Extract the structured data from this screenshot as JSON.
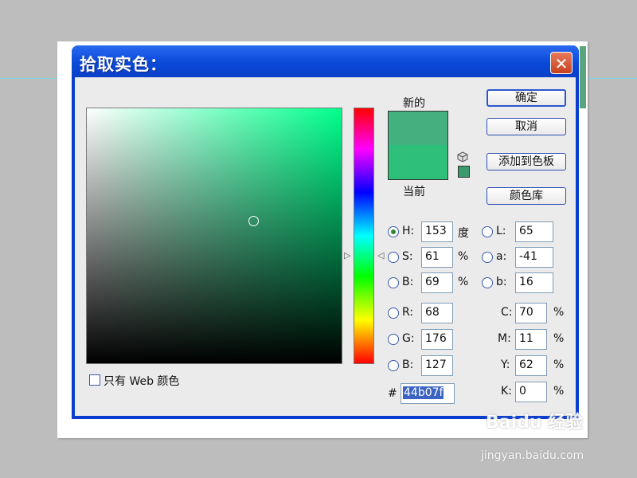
{
  "dialog": {
    "title": "拾取实色：",
    "close_glyph": "✕"
  },
  "picker": {
    "label_new": "新的",
    "label_current": "当前",
    "new_color": "#44b07f",
    "current_color": "#2ebf7a",
    "web_swatch_color": "#3a9a6c",
    "hue_arrow_left": "▷",
    "hue_arrow_right": "◁"
  },
  "buttons": {
    "ok": "确定",
    "cancel": "取消",
    "add_to_swatches": "添加到色板",
    "color_libraries": "颜色库"
  },
  "hsb": {
    "h_label": "H:",
    "h_value": "153",
    "h_unit": "度",
    "s_label": "S:",
    "s_value": "61",
    "s_unit": "%",
    "b_label": "B:",
    "b_value": "69",
    "b_unit": "%"
  },
  "rgb": {
    "r_label": "R:",
    "r_value": "68",
    "g_label": "G:",
    "g_value": "176",
    "b_label": "B:",
    "b_value": "127"
  },
  "lab": {
    "l_label": "L:",
    "l_value": "65",
    "a_label": "a:",
    "a_value": "-41",
    "b_label": "b:",
    "b_value": "16"
  },
  "cmyk": {
    "c_label": "C:",
    "c_value": "70",
    "c_unit": "%",
    "m_label": "M:",
    "m_value": "11",
    "m_unit": "%",
    "y_label": "Y:",
    "y_value": "62",
    "y_unit": "%",
    "k_label": "K:",
    "k_value": "0",
    "k_unit": "%"
  },
  "hex": {
    "label": "#",
    "value": "44b07f"
  },
  "web_only": {
    "label": "只有 Web 颜色",
    "checked": false
  },
  "watermark": {
    "text": "Baidu 经验",
    "url": "jingyan.baidu.com"
  },
  "selected_mode": "H"
}
